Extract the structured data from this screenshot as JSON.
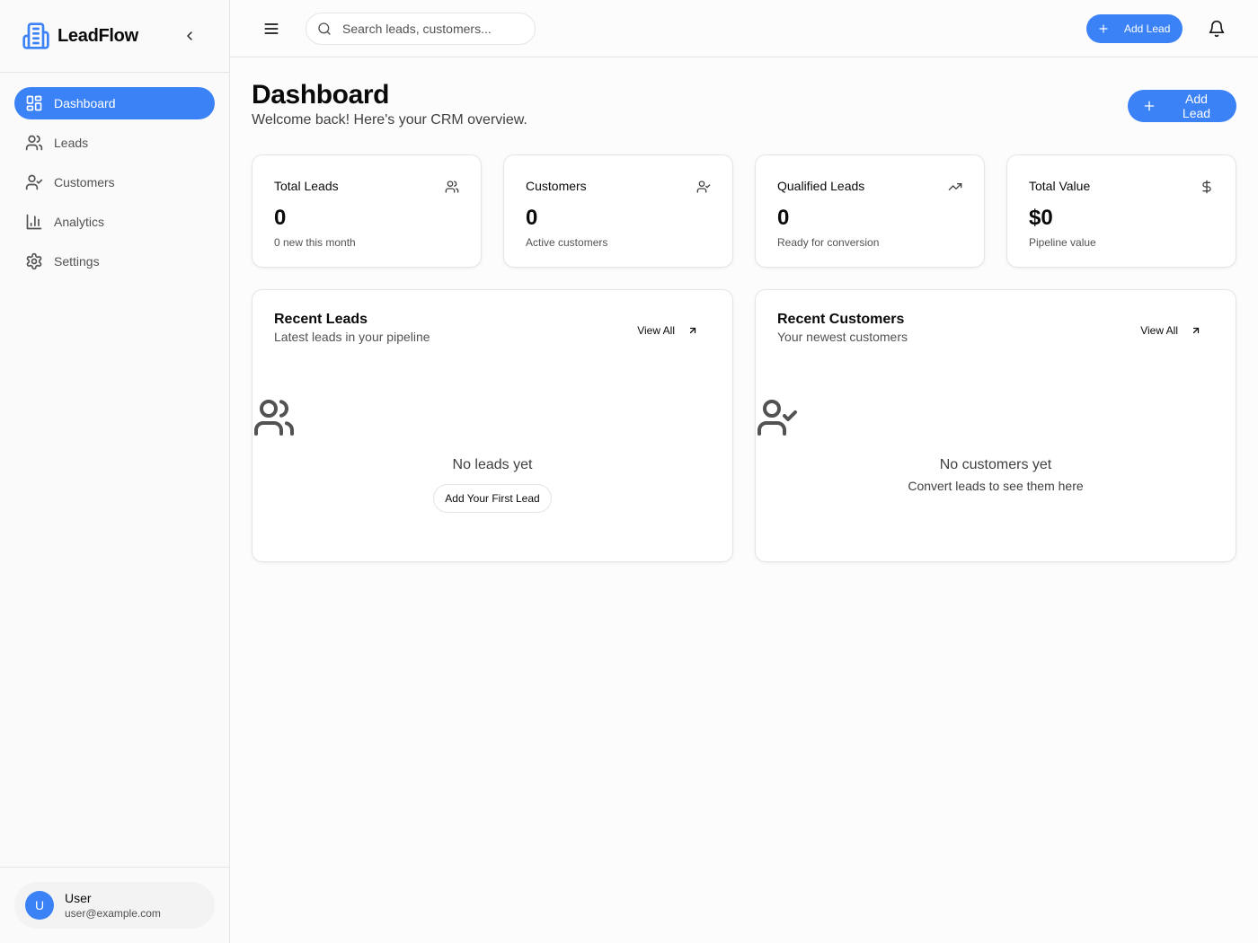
{
  "brand": {
    "name": "LeadFlow",
    "accent_color": "#3b82f6"
  },
  "sidebar": {
    "items": [
      {
        "label": "Dashboard",
        "icon": "layout-grid-icon",
        "active": true
      },
      {
        "label": "Leads",
        "icon": "users-icon"
      },
      {
        "label": "Customers",
        "icon": "user-check-icon"
      },
      {
        "label": "Analytics",
        "icon": "bar-chart-icon"
      },
      {
        "label": "Settings",
        "icon": "gear-icon"
      }
    ],
    "user": {
      "initial": "U",
      "name": "User",
      "email": "user@example.com"
    }
  },
  "topbar": {
    "search_placeholder": "Search leads, customers...",
    "add_lead_label": "Add Lead"
  },
  "page": {
    "title": "Dashboard",
    "subtitle": "Welcome back! Here's your CRM overview.",
    "add_lead_label": "Add Lead"
  },
  "stats": [
    {
      "label": "Total Leads",
      "value": "0",
      "sub": "0 new this month",
      "icon": "users-icon"
    },
    {
      "label": "Customers",
      "value": "0",
      "sub": "Active customers",
      "icon": "user-check-icon"
    },
    {
      "label": "Qualified Leads",
      "value": "0",
      "sub": "Ready for conversion",
      "icon": "trending-up-icon"
    },
    {
      "label": "Total Value",
      "value": "$0",
      "sub": "Pipeline value",
      "icon": "dollar-icon"
    }
  ],
  "recent_leads": {
    "title": "Recent Leads",
    "subtitle": "Latest leads in your pipeline",
    "view_all": "View All",
    "empty_title": "No leads yet",
    "empty_button": "Add Your First Lead"
  },
  "recent_customers": {
    "title": "Recent Customers",
    "subtitle": "Your newest customers",
    "view_all": "View All",
    "empty_title": "No customers yet",
    "empty_sub": "Convert leads to see them here"
  }
}
